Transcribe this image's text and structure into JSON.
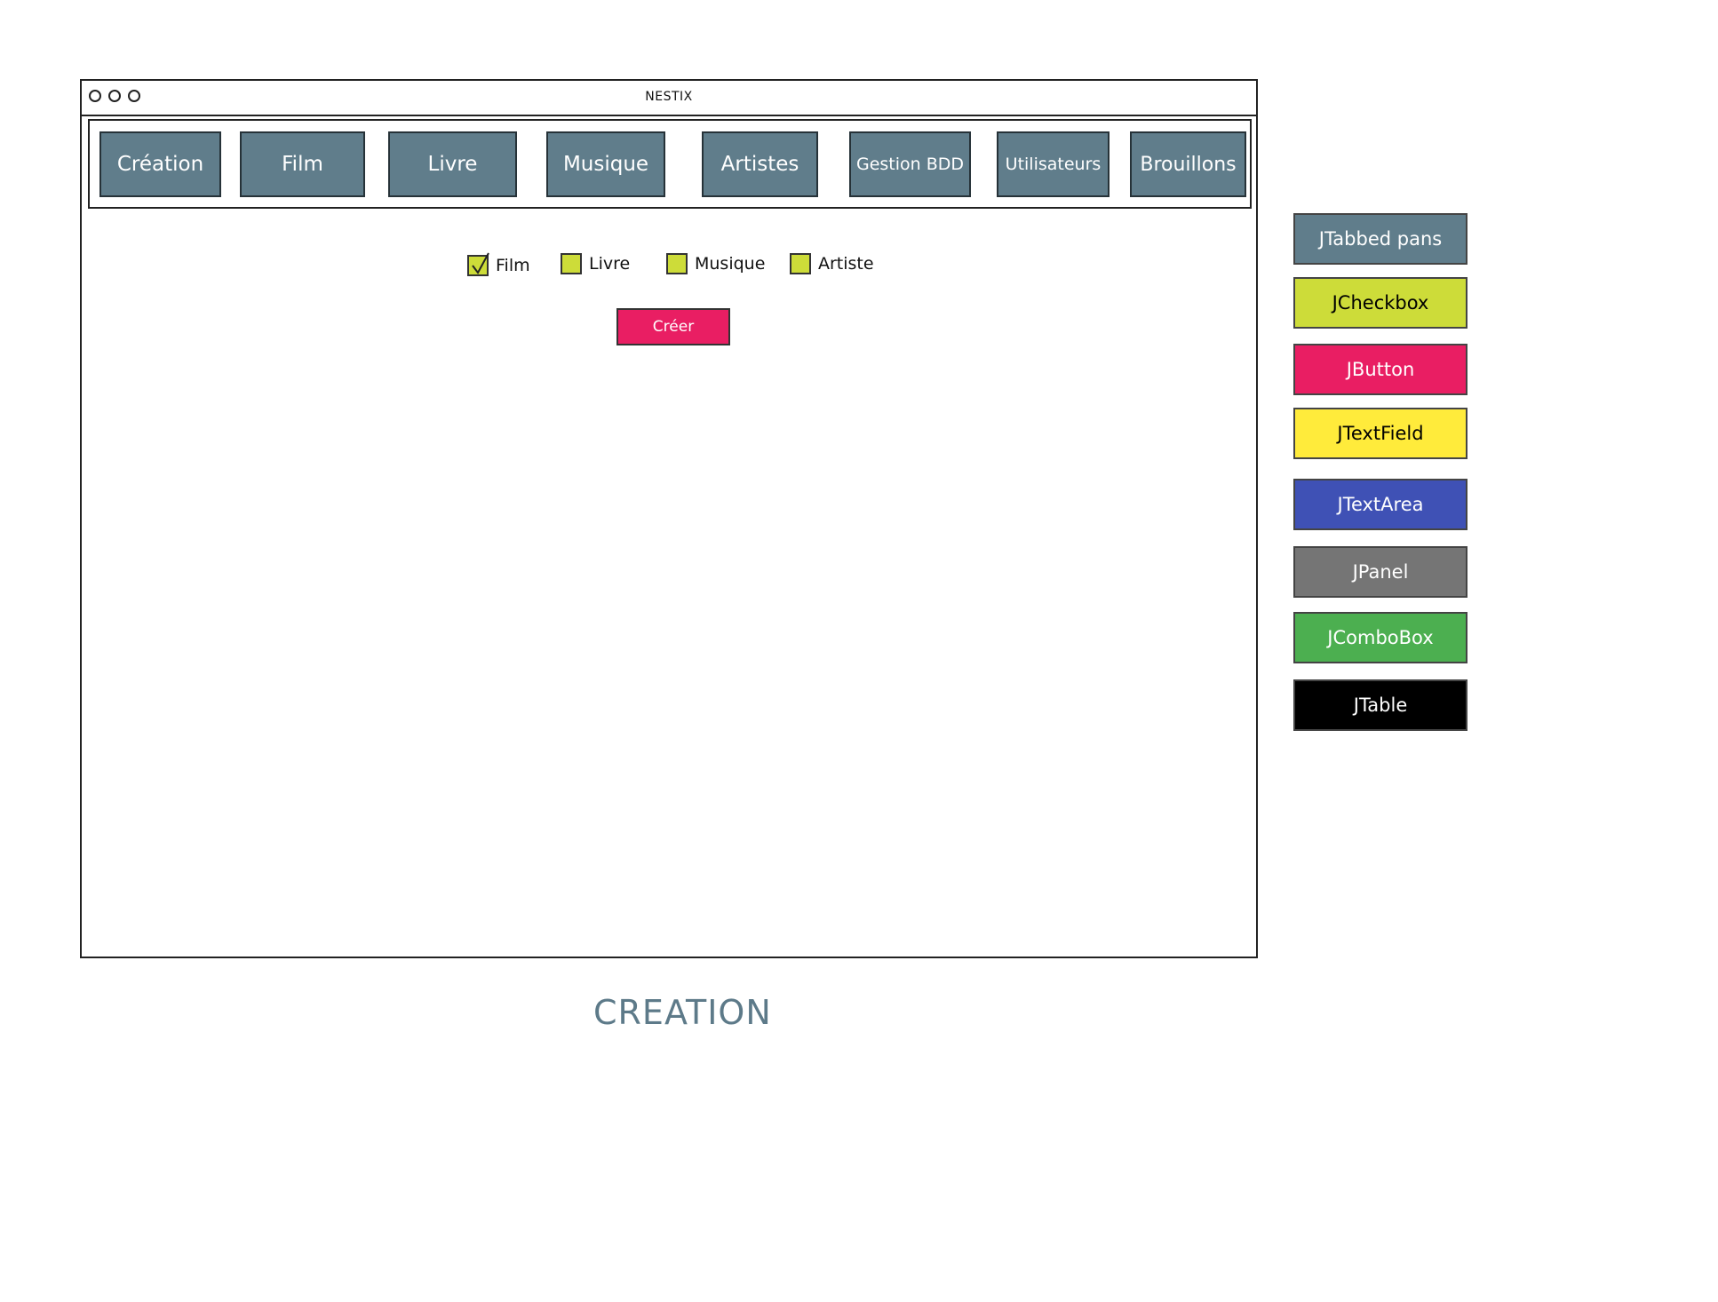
{
  "window": {
    "title": "NESTIX"
  },
  "tabs": [
    {
      "label": "Création"
    },
    {
      "label": "Film"
    },
    {
      "label": "Livre"
    },
    {
      "label": "Musique"
    },
    {
      "label": "Artistes"
    },
    {
      "label": "Gestion BDD"
    },
    {
      "label": "Utilisateurs"
    },
    {
      "label": "Brouillons"
    }
  ],
  "checkboxes": [
    {
      "label": "Film",
      "checked": true
    },
    {
      "label": "Livre",
      "checked": false
    },
    {
      "label": "Musique",
      "checked": false
    },
    {
      "label": "Artiste",
      "checked": false
    }
  ],
  "create_button": {
    "label": "Créer"
  },
  "caption": "CREATION",
  "legend": [
    {
      "label": "JTabbed pans",
      "color": "#607d8b",
      "text_color": "#ffffff"
    },
    {
      "label": "JCheckbox",
      "color": "#cddc39",
      "text_color": "#000000"
    },
    {
      "label": "JButton",
      "color": "#e91e63",
      "text_color": "#ffffff"
    },
    {
      "label": "JTextField",
      "color": "#ffeb3b",
      "text_color": "#000000"
    },
    {
      "label": "JTextArea",
      "color": "#3f51b5",
      "text_color": "#ffffff"
    },
    {
      "label": "JPanel",
      "color": "#757575",
      "text_color": "#ffffff"
    },
    {
      "label": "JComboBox",
      "color": "#4caf50",
      "text_color": "#ffffff"
    },
    {
      "label": "JTable",
      "color": "#000000",
      "text_color": "#ffffff"
    }
  ]
}
